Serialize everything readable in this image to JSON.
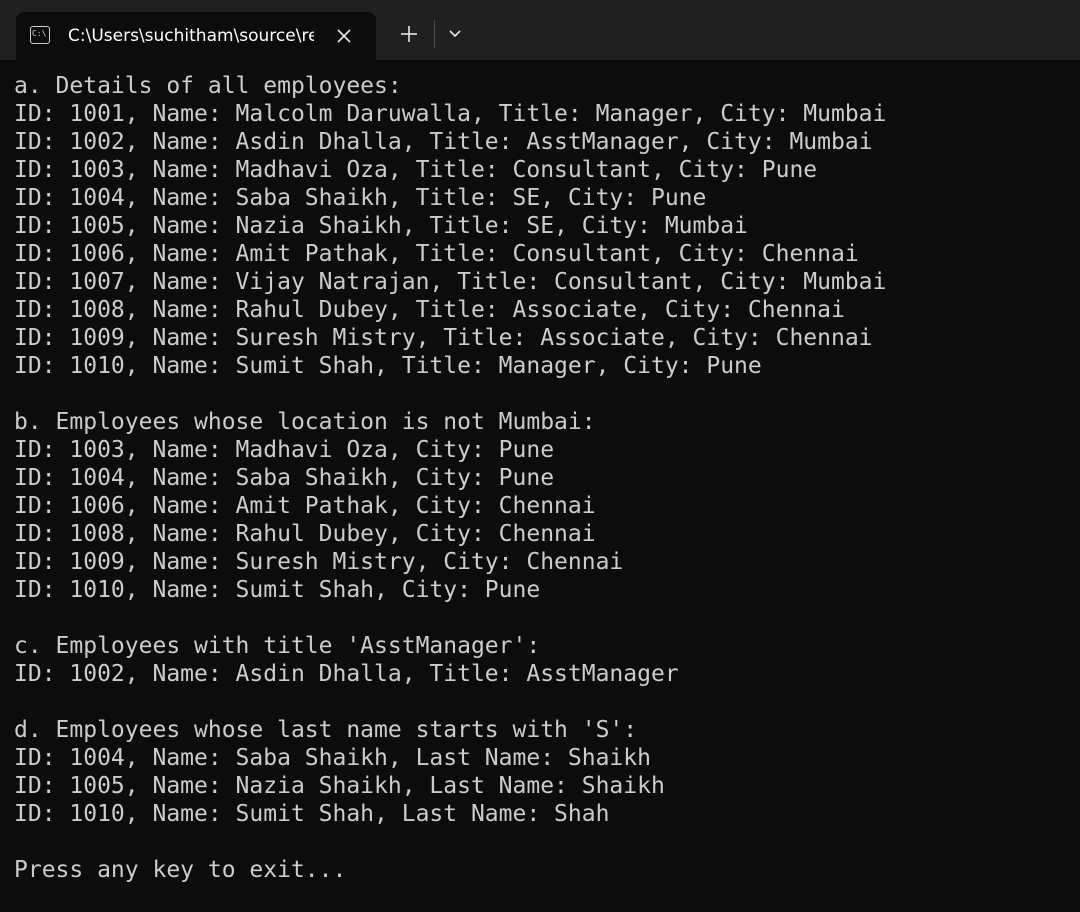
{
  "tab": {
    "title": "C:\\Users\\suchitham\\source\\re",
    "icon": "terminal-icon",
    "close_icon": "close-icon"
  },
  "titlebar": {
    "new_tab_icon": "plus-icon",
    "dropdown_icon": "chevron-down-icon"
  },
  "terminal": {
    "lines": [
      "a. Details of all employees:",
      "ID: 1001, Name: Malcolm Daruwalla, Title: Manager, City: Mumbai",
      "ID: 1002, Name: Asdin Dhalla, Title: AsstManager, City: Mumbai",
      "ID: 1003, Name: Madhavi Oza, Title: Consultant, City: Pune",
      "ID: 1004, Name: Saba Shaikh, Title: SE, City: Pune",
      "ID: 1005, Name: Nazia Shaikh, Title: SE, City: Mumbai",
      "ID: 1006, Name: Amit Pathak, Title: Consultant, City: Chennai",
      "ID: 1007, Name: Vijay Natrajan, Title: Consultant, City: Mumbai",
      "ID: 1008, Name: Rahul Dubey, Title: Associate, City: Chennai",
      "ID: 1009, Name: Suresh Mistry, Title: Associate, City: Chennai",
      "ID: 1010, Name: Sumit Shah, Title: Manager, City: Pune",
      "",
      "b. Employees whose location is not Mumbai:",
      "ID: 1003, Name: Madhavi Oza, City: Pune",
      "ID: 1004, Name: Saba Shaikh, City: Pune",
      "ID: 1006, Name: Amit Pathak, City: Chennai",
      "ID: 1008, Name: Rahul Dubey, City: Chennai",
      "ID: 1009, Name: Suresh Mistry, City: Chennai",
      "ID: 1010, Name: Sumit Shah, City: Pune",
      "",
      "c. Employees with title 'AsstManager':",
      "ID: 1002, Name: Asdin Dhalla, Title: AsstManager",
      "",
      "d. Employees whose last name starts with 'S':",
      "ID: 1004, Name: Saba Shaikh, Last Name: Shaikh",
      "ID: 1005, Name: Nazia Shaikh, Last Name: Shaikh",
      "ID: 1010, Name: Sumit Shah, Last Name: Shah",
      "",
      "Press any key to exit..."
    ]
  },
  "colors": {
    "background": "#0c0c0c",
    "titlebar": "#202020",
    "text": "#cccccc"
  }
}
